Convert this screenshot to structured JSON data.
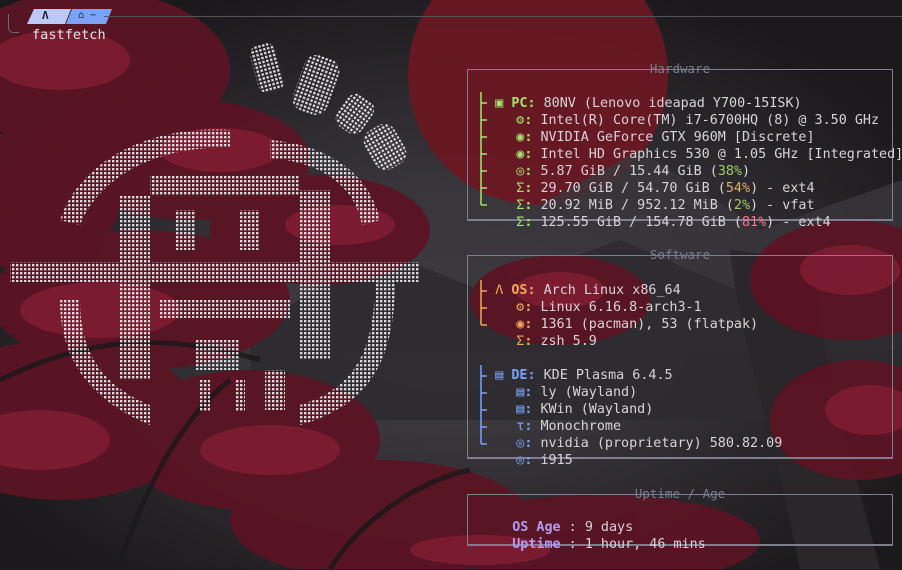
{
  "prompt": {
    "os_glyph": "Λ",
    "path_glyph": "⌂ ~",
    "command": "fastfetch"
  },
  "colors": {
    "hardware": "#a6e36f",
    "software": "#f2a95c",
    "desktop": "#7aa2f7",
    "uptime": "#b79af5",
    "box_border": "#7d7f8e"
  },
  "hardware": {
    "title": "Hardware",
    "pc": {
      "icon": "laptop-icon",
      "key": "PC:",
      "value": "80NV (Lenovo ideapad Y700-15ISK)"
    },
    "cpu": {
      "icon": "cpu-icon",
      "key": ":",
      "value": "Intel(R) Core(TM) i7-6700HQ (8) @ 3.50 GHz"
    },
    "gpu1": {
      "icon": "gpu-icon",
      "key": ":",
      "value": "NVIDIA GeForce GTX 960M [Discrete]"
    },
    "gpu2": {
      "icon": "gpu-icon",
      "key": ":",
      "value": "Intel HD Graphics 530 @ 1.05 GHz [Integrated]"
    },
    "memory": {
      "icon": "memory-icon",
      "key": ":",
      "value_pre": "5.87 GiB / 15.44 GiB (",
      "pct": "38%",
      "value_post": ")"
    },
    "disk1": {
      "icon": "disk-icon",
      "key": ":",
      "value_pre": "29.70 GiB / 54.70 GiB (",
      "pct": "54%",
      "value_post": ") - ext4"
    },
    "disk2": {
      "icon": "disk-icon",
      "key": ":",
      "value_pre": "20.92 MiB / 952.12 MiB (",
      "pct": "2%",
      "value_post": ") - vfat"
    },
    "disk3": {
      "icon": "disk-icon",
      "key": ":",
      "value_pre": "125.55 GiB / 154.78 GiB (",
      "pct": "81%",
      "value_post": ") - ext4"
    }
  },
  "software": {
    "title": "Software",
    "os": {
      "icon": "arch-icon",
      "key": "OS:",
      "value": "Arch Linux x86_64"
    },
    "kernel": {
      "icon": "kernel-icon",
      "key": ":",
      "value": "Linux 6.16.8-arch3-1"
    },
    "packages": {
      "icon": "package-icon",
      "key": ":",
      "value": "1361 (pacman), 53 (flatpak)"
    },
    "shell": {
      "icon": "shell-icon",
      "key": ":",
      "value": "zsh 5.9"
    },
    "de": {
      "icon": "desktop-icon",
      "key": "DE:",
      "value": "KDE Plasma 6.4.5"
    },
    "lm": {
      "icon": "login-icon",
      "key": ":",
      "value": "ly (Wayland)"
    },
    "wm": {
      "icon": "window-icon",
      "key": ":",
      "value": "KWin (Wayland)"
    },
    "theme": {
      "icon": "brush-icon",
      "key": ":",
      "value": "Monochrome"
    },
    "driver1": {
      "icon": "driver-icon",
      "key": ":",
      "value": "nvidia (proprietary) 580.82.09"
    },
    "driver2": {
      "icon": "driver-icon",
      "key": ":",
      "value": "i915"
    }
  },
  "uptime": {
    "title": "Uptime / Age",
    "os_age": {
      "key": "OS Age",
      "sep": " : ",
      "value": "9 days"
    },
    "uptime": {
      "key": "Uptime",
      "sep": " : ",
      "value": "1 hour, 46 mins"
    }
  }
}
